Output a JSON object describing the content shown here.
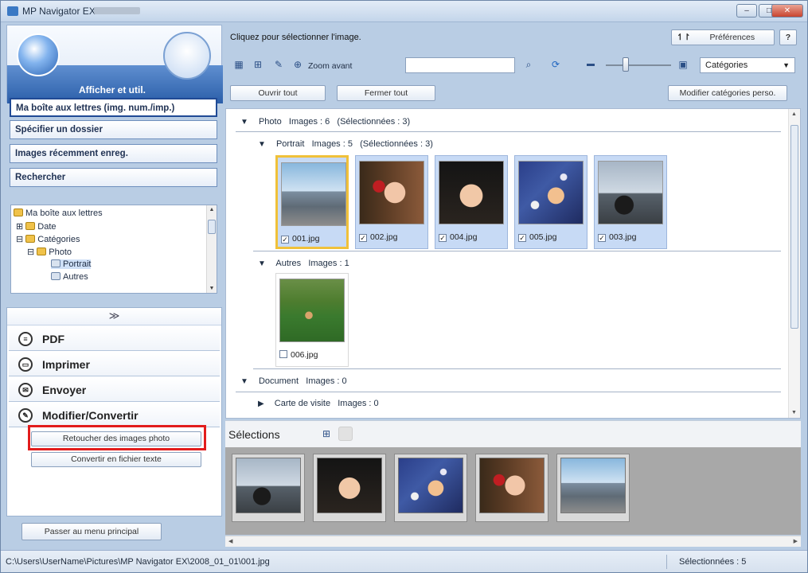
{
  "window": {
    "title": "MP Navigator EX",
    "buttons": [
      "–",
      "□",
      "✕"
    ]
  },
  "left_panel": {
    "header_title": "Afficher et util.",
    "nav": [
      {
        "label": "Ma boîte aux lettres (img. num./imp.)",
        "active": true
      },
      {
        "label": "Spécifier un dossier",
        "active": false
      },
      {
        "label": "Images récemment enreg.",
        "active": false
      },
      {
        "label": "Rechercher",
        "active": false
      }
    ],
    "tree": [
      {
        "label": "Ma boîte aux lettres",
        "level": 0,
        "prefix": ""
      },
      {
        "label": "Date",
        "level": 1,
        "prefix": "⊞"
      },
      {
        "label": "Catégories",
        "level": 1,
        "prefix": "⊟"
      },
      {
        "label": "Photo",
        "level": 2,
        "prefix": "⊟"
      },
      {
        "label": "Portrait",
        "level": 3,
        "prefix": "",
        "selected": true
      },
      {
        "label": "Autres",
        "level": 3,
        "prefix": ""
      }
    ],
    "collapse_glyph": "≫",
    "functions": [
      {
        "label": "PDF",
        "icon": "pdf-icon"
      },
      {
        "label": "Imprimer",
        "icon": "print-icon"
      },
      {
        "label": "Envoyer",
        "icon": "send-icon"
      },
      {
        "label": "Modifier/Convertir",
        "icon": "edit-icon"
      }
    ],
    "sub_buttons": [
      "Retoucher des images photo",
      "Convertir en fichier texte"
    ],
    "main_menu_button": "Passer au menu principal"
  },
  "right_panel": {
    "instruction": "Cliquez pour sélectionner l'image.",
    "preferences_button": "Préférences",
    "preferences_glyph": "↿↾",
    "help_button": "?",
    "zoom_label": "Zoom avant",
    "search_value": "",
    "category_select": "Catégories",
    "open_all": "Ouvrir tout",
    "close_all": "Fermer tout",
    "modify_categories": "Modifier catégories perso.",
    "groups": {
      "photo": {
        "title": "Photo",
        "count": "Images : 6",
        "selected": "(Sélectionnées : 3)"
      },
      "portrait": {
        "title": "Portrait",
        "count": "Images : 5",
        "selected": "(Sélectionnées : 3)"
      },
      "autres": {
        "title": "Autres",
        "count": "Images : 1"
      },
      "document": {
        "title": "Document",
        "count": "Images : 0"
      },
      "carte": {
        "title": "Carte de visite",
        "count": "Images : 0"
      }
    },
    "portrait_images": [
      {
        "name": "001.jpg",
        "checked": true,
        "style": "p-beach",
        "highlight": true
      },
      {
        "name": "002.jpg",
        "checked": true,
        "style": "p-face-red",
        "highlight": false
      },
      {
        "name": "004.jpg",
        "checked": true,
        "style": "p-face-dark",
        "highlight": false
      },
      {
        "name": "005.jpg",
        "checked": true,
        "style": "p-flowers",
        "highlight": false
      },
      {
        "name": "003.jpg",
        "checked": true,
        "style": "p-silhouette",
        "highlight": false
      }
    ],
    "autres_images": [
      {
        "name": "006.jpg",
        "checked": false,
        "style": "p-grass"
      }
    ],
    "selections_title": "Sélections",
    "selection_thumbs": [
      "p-silhouette",
      "p-face-dark",
      "p-flowers",
      "p-face-red",
      "p-beach"
    ]
  },
  "status": {
    "path": "C:\\Users\\UserName\\Pictures\\MP Navigator EX\\2008_01_01\\001.jpg",
    "selected": "Sélectionnées : 5"
  },
  "colors": {
    "highlight_border": "#e21c1c",
    "selected_thumb": "#f0c13a",
    "accent": "#2b5ea9"
  }
}
